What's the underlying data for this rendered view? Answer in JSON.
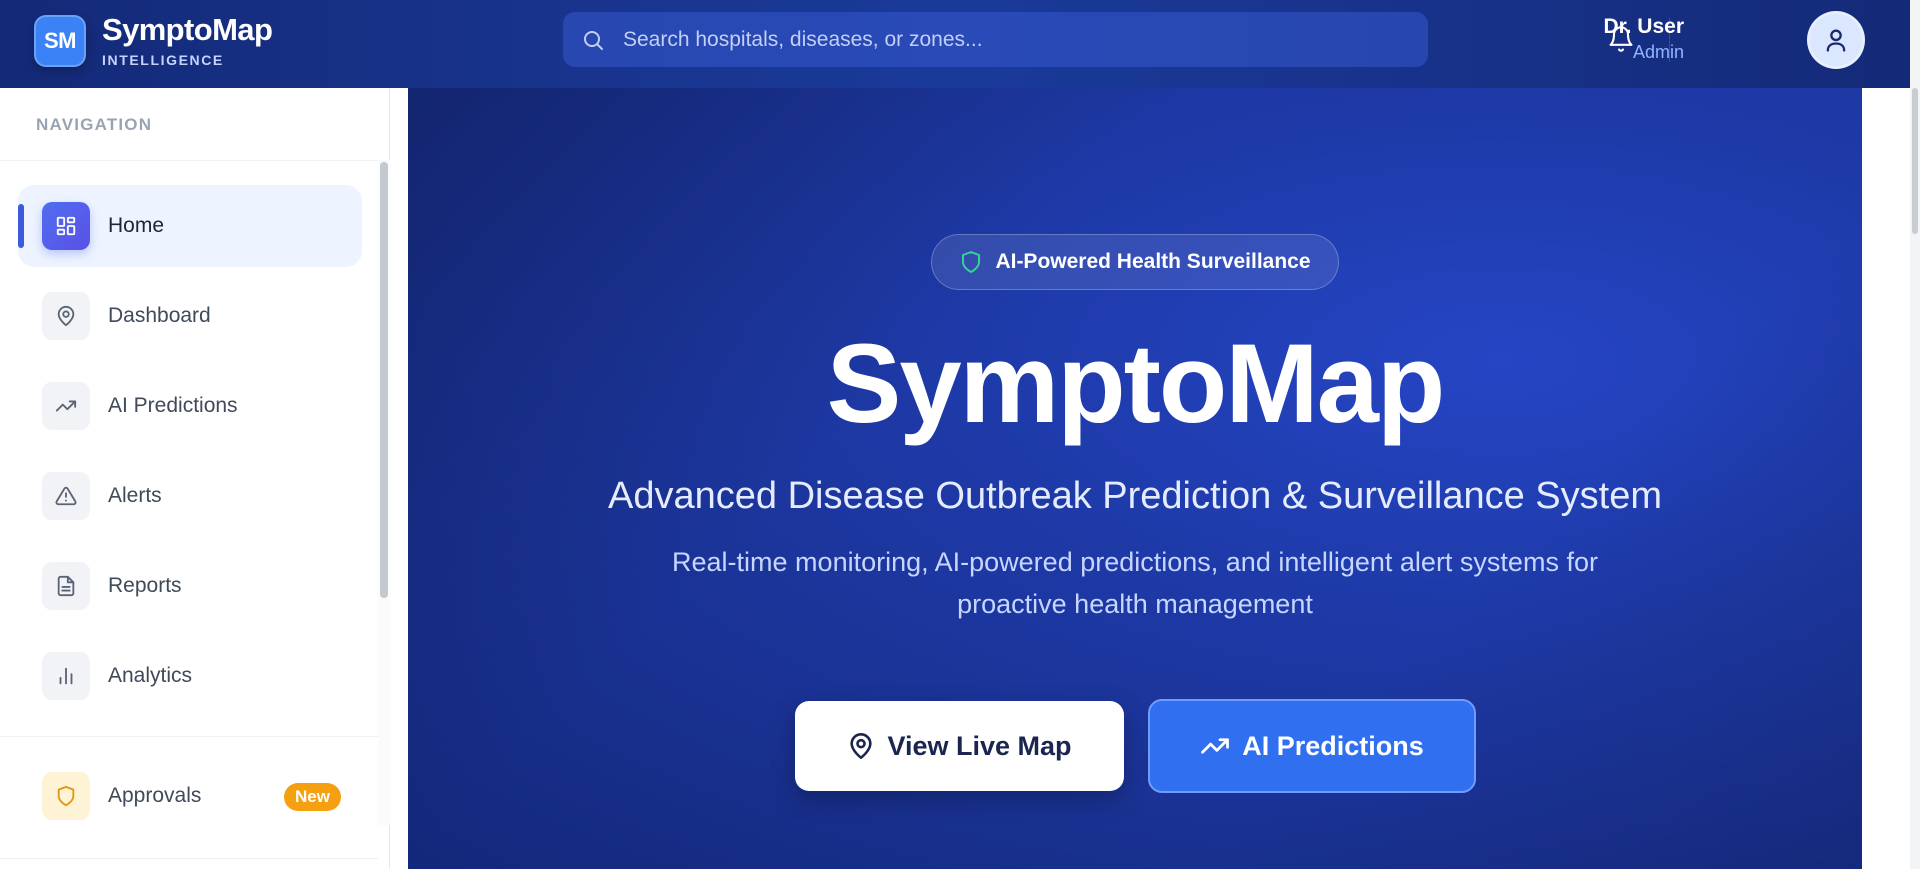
{
  "header": {
    "logo_text": "SM",
    "brand_name": "SymptoMap",
    "brand_sub": "INTELLIGENCE",
    "search_placeholder": "Search hospitals, diseases, or zones...",
    "user_name": "Dr. User",
    "user_role": "Admin"
  },
  "sidebar": {
    "heading": "NAVIGATION",
    "items": [
      {
        "label": "Home",
        "icon": "grid-icon",
        "active": true
      },
      {
        "label": "Dashboard",
        "icon": "map-pin-icon"
      },
      {
        "label": "AI Predictions",
        "icon": "trending-up-icon"
      },
      {
        "label": "Alerts",
        "icon": "warning-triangle-icon"
      },
      {
        "label": "Reports",
        "icon": "document-icon"
      },
      {
        "label": "Analytics",
        "icon": "bar-chart-icon"
      }
    ],
    "approvals": {
      "label": "Approvals",
      "badge": "New",
      "icon": "shield-icon"
    }
  },
  "hero": {
    "pill_text": "AI-Powered Health Surveillance",
    "title": "SymptoMap",
    "subtitle": "Advanced Disease Outbreak Prediction & Surveillance System",
    "description": "Real-time monitoring, AI-powered predictions, and intelligent alert systems for proactive health management",
    "btn_map": "View Live Map",
    "btn_ai": "AI Predictions"
  },
  "colors": {
    "header_bg": "#142a78",
    "hero_bg": "#1e3aa8",
    "accent": "#3b5bdb",
    "badge": "#f5a011",
    "primary_button": "#2f6ff0"
  }
}
